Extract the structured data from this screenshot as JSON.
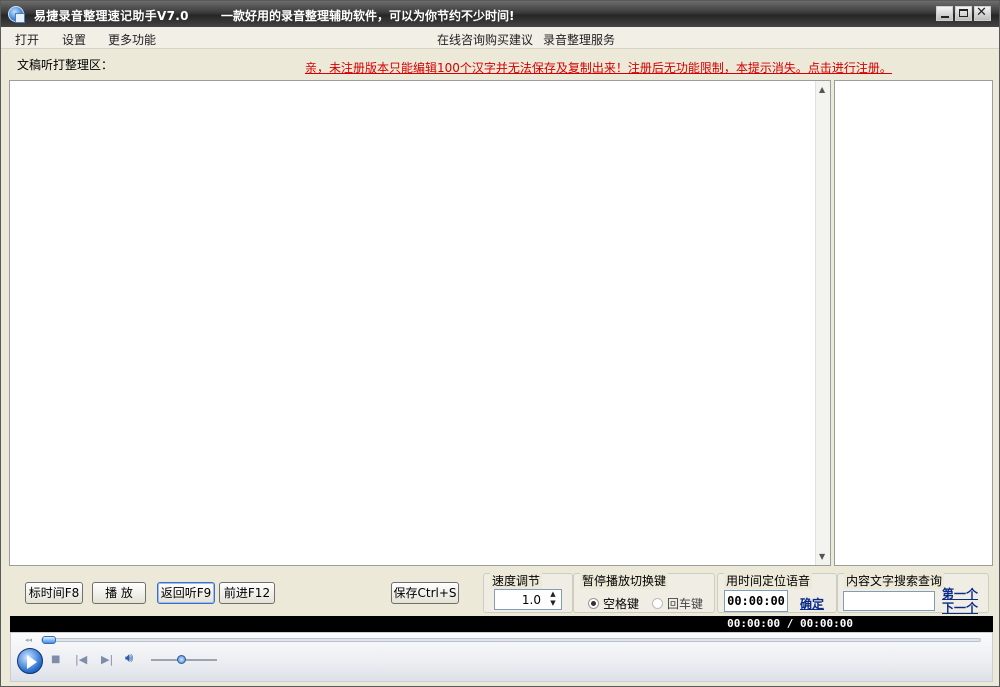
{
  "window": {
    "title": "易捷录音整理速记助手V7.0",
    "slogan": "一款好用的录音整理辅助软件，可以为你节约不少时间!"
  },
  "menu": {
    "items": [
      "打开",
      "设置",
      "更多功能"
    ],
    "right_items": [
      "在线咨询购买建议",
      "录音整理服务"
    ]
  },
  "transcript": {
    "label": "文稿听打整理区：",
    "nag_notice": "亲，未注册版本只能编辑100个汉字并无法保存及复制出来！注册后无功能限制，本提示消失。点击进行注册。",
    "content": ""
  },
  "controls": {
    "mark_time": "标时间F8",
    "play": "播 放",
    "rewind": "返回听F9",
    "forward": "前进F12",
    "save": "保存Ctrl+S",
    "speed": {
      "title": "速度调节",
      "value": "1.0"
    },
    "pause_key": {
      "title": "暂停播放切换键",
      "options": [
        "空格键",
        "回车键"
      ],
      "selected": 0
    },
    "time_locate": {
      "title": "用时间定位语音",
      "value": "00:00:00",
      "confirm": "确定"
    },
    "search": {
      "title": "内容文字搜索查询",
      "value": "",
      "first": "第一个",
      "next": "下一个"
    }
  },
  "player": {
    "current_time": "00:00:00",
    "total_time": "00:00:00",
    "seek_progress": 0,
    "volume_level": 0.45
  },
  "colors": {
    "titlebar": "#3a3a3a",
    "nag_text": "#d40000",
    "link": "#0a2a8a"
  }
}
